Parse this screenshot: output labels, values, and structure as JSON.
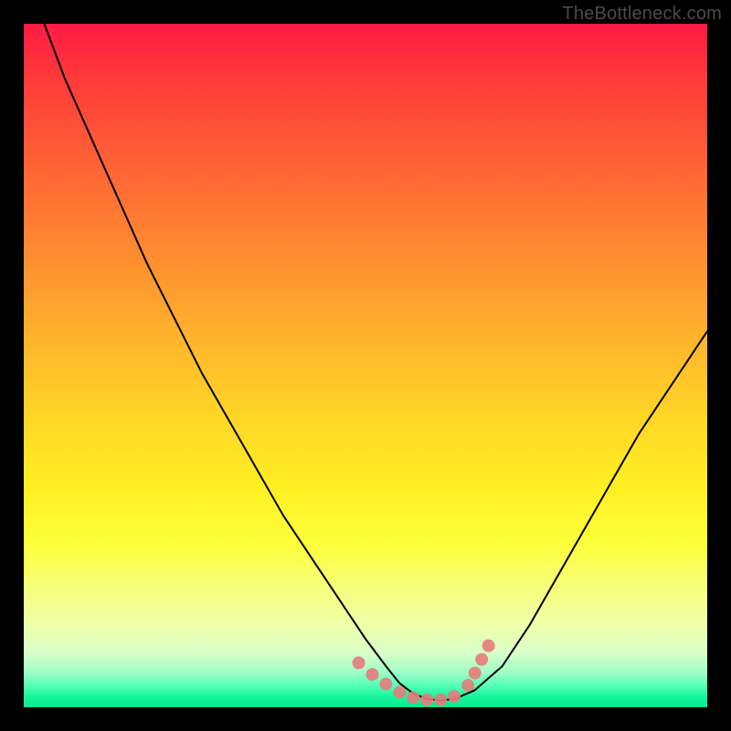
{
  "watermark": "TheBottleneck.com",
  "chart_data": {
    "type": "line",
    "title": "",
    "xlabel": "",
    "ylabel": "",
    "xlim": [
      0,
      100
    ],
    "ylim": [
      0,
      100
    ],
    "grid": false,
    "legend": false,
    "background": {
      "style": "vertical-gradient",
      "stops": [
        {
          "pos": 0.0,
          "color": "#ff1a44"
        },
        {
          "pos": 0.5,
          "color": "#ffba2a"
        },
        {
          "pos": 0.8,
          "color": "#fdff3a"
        },
        {
          "pos": 1.0,
          "color": "#0be890"
        }
      ]
    },
    "series": [
      {
        "name": "bottleneck-curve",
        "style": "line",
        "color": "#000000",
        "stroke_width": 2,
        "x": [
          3,
          6,
          10,
          14,
          18,
          22,
          26,
          30,
          34,
          38,
          42,
          46,
          50,
          53,
          55,
          57,
          59,
          61,
          63,
          66,
          70,
          74,
          78,
          82,
          86,
          90,
          94,
          98,
          100
        ],
        "y": [
          100,
          92,
          83,
          74,
          65,
          57,
          49,
          42,
          35,
          28,
          22,
          16,
          10,
          6,
          3.5,
          2,
          1.2,
          1,
          1.2,
          2.5,
          6,
          12,
          19,
          26,
          33,
          40,
          46,
          52,
          55
        ]
      },
      {
        "name": "optimal-marker-dots",
        "style": "scatter",
        "color": "#e77b7b",
        "marker_radius": 7,
        "x": [
          49,
          51,
          53,
          55,
          57,
          59,
          61,
          63,
          65,
          66,
          67,
          68
        ],
        "y": [
          6.5,
          4.8,
          3.4,
          2.2,
          1.4,
          1.1,
          1.1,
          1.6,
          3.2,
          5.0,
          7.0,
          9.0
        ]
      }
    ]
  }
}
